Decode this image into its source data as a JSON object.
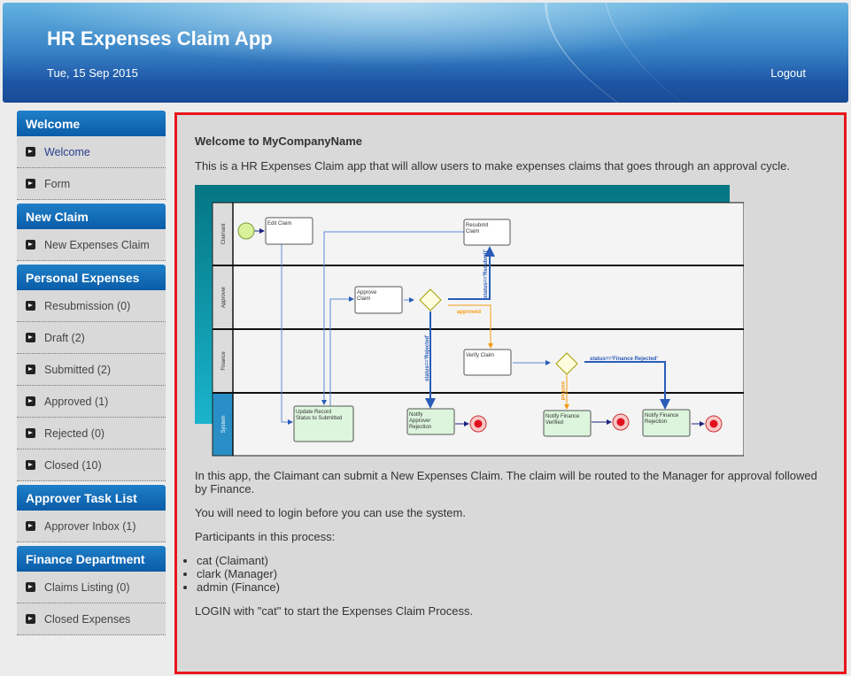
{
  "header": {
    "title": "HR Expenses Claim App",
    "date": "Tue, 15 Sep 2015",
    "logout": "Logout"
  },
  "sidebar": [
    {
      "title": "Welcome",
      "items": [
        "Welcome",
        "Form"
      ]
    },
    {
      "title": "New Claim",
      "items": [
        "New Expenses Claim"
      ]
    },
    {
      "title": "Personal Expenses",
      "items": [
        "Resubmission (0)",
        "Draft (2)",
        "Submitted (2)",
        "Approved (1)",
        "Rejected (0)",
        "Closed (10)"
      ]
    },
    {
      "title": "Approver Task List",
      "items": [
        "Approver Inbox (1)"
      ]
    },
    {
      "title": "Finance Department",
      "items": [
        "Claims Listing (0)",
        "Closed Expenses"
      ]
    }
  ],
  "main": {
    "heading": "Welcome to MyCompanyName",
    "intro": "This is a HR Expenses Claim app that will allow users to make expenses claims that goes through an approval cycle.",
    "p1": "In this app, the Claimant can submit a New Expenses Claim. The claim will be routed to the Manager for approval followed by Finance.",
    "p2": "You will need to login before you can use the system.",
    "p3": "Participants in this process:",
    "participants": [
      "cat (Claimant)",
      "clark (Manager)",
      "admin (Finance)"
    ],
    "p4": "LOGIN with \"cat\" to start the Expenses Claim Process."
  },
  "diagram": {
    "lanes": [
      "Claimant",
      "Approver",
      "Finance",
      "System"
    ],
    "tasks": {
      "edit": "Edit Claim",
      "resubmit": [
        "Resubmit",
        "Claim"
      ],
      "approve": [
        "Approve",
        "Claim"
      ],
      "verify": "Verify Claim",
      "update": [
        "Update Record",
        "Status to Submitted"
      ],
      "nar": [
        "Notify",
        "Approver",
        "Rejection"
      ],
      "nfv": [
        "Notify Finance",
        "Verified"
      ],
      "nfr": [
        "Notify Finance",
        "Rejection"
      ]
    },
    "flows": {
      "resubmit": "status=='Resubmit'",
      "approved": "approved",
      "rejected": "status=='Rejected'",
      "verified": "verified",
      "finance_rejected": "status=='Finance Rejected'"
    }
  }
}
